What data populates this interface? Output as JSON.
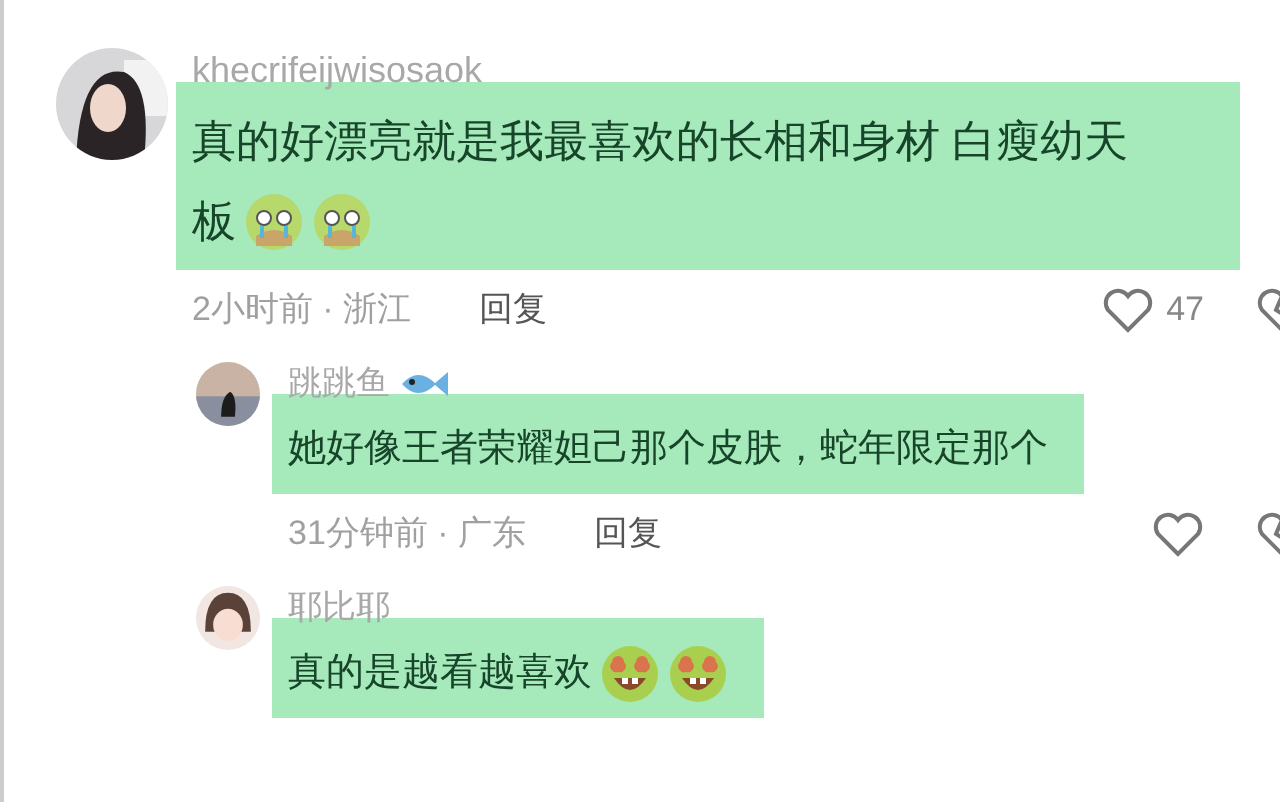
{
  "comments": [
    {
      "reply": false,
      "avatar": {
        "kind": "picture"
      },
      "name": "khecrifeijwisosaok",
      "highlighted": true,
      "lines": [
        "真的好漂亮就是我最喜欢的长相和身材 白瘦幼天",
        "板"
      ],
      "emojis": [
        {
          "kind": "pleading"
        },
        {
          "kind": "pleading"
        }
      ],
      "time_location": "2小时前 · 浙江",
      "reply_label": "回复",
      "likes": "47"
    },
    {
      "reply": true,
      "avatar": {
        "kind": "picture"
      },
      "name": "跳跳鱼",
      "name_emojis": [
        {
          "kind": "fish"
        }
      ],
      "highlighted": true,
      "lines": [
        "她好像王者荣耀妲己那个皮肤，蛇年限定那个"
      ],
      "time_location": "31分钟前 · 广东",
      "reply_label": "回复"
    },
    {
      "reply": true,
      "avatar": {
        "kind": "picture"
      },
      "name": "耶比耶",
      "highlighted": true,
      "lines": [
        "真的是越看越喜欢"
      ],
      "emojis": [
        {
          "kind": "heart-eyes"
        },
        {
          "kind": "heart-eyes"
        }
      ]
    }
  ]
}
